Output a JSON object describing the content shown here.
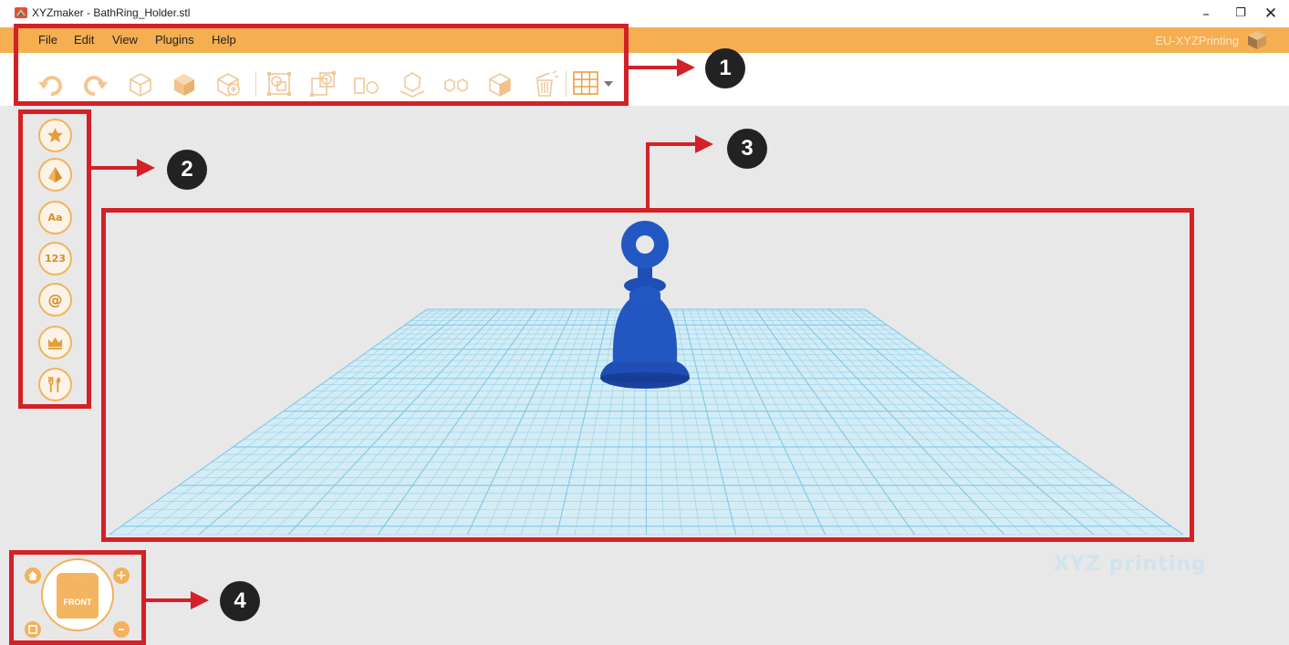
{
  "window": {
    "title": "XYZmaker - BathRing_Holder.stl",
    "minimize": "–",
    "maximize": "❐",
    "close": "✕"
  },
  "menu": {
    "items": [
      "File",
      "Edit",
      "View",
      "Plugins",
      "Help"
    ],
    "account": "EU-XYZPrinting"
  },
  "toolbar": {
    "icons": [
      "undo-icon",
      "redo-icon",
      "cube-outline-icon",
      "cube-filled-icon",
      "cube-add-icon",
      "group-icon",
      "ungroup-icon",
      "align-icon",
      "drop-to-bed-icon",
      "mirror-icon",
      "cube-half-icon",
      "delete-icon",
      "grid-icon"
    ]
  },
  "sidebar": {
    "buttons": [
      {
        "name": "favorites",
        "text": ""
      },
      {
        "name": "shapes",
        "text": ""
      },
      {
        "name": "text",
        "text": "Aa"
      },
      {
        "name": "numbers",
        "text": "123"
      },
      {
        "name": "symbols",
        "text": "@"
      },
      {
        "name": "crown",
        "text": ""
      },
      {
        "name": "tools",
        "text": ""
      }
    ]
  },
  "viewport": {
    "brand": "XYZ printing",
    "model_color": "#1f4fb4",
    "grid_color": "#7cc7e6"
  },
  "view_control": {
    "face_label": "FRONT",
    "face_small": "· · · · ·"
  },
  "callouts": [
    "1",
    "2",
    "3",
    "4"
  ],
  "colors": {
    "accent": "#f5ae50",
    "annotation": "#d42027"
  }
}
